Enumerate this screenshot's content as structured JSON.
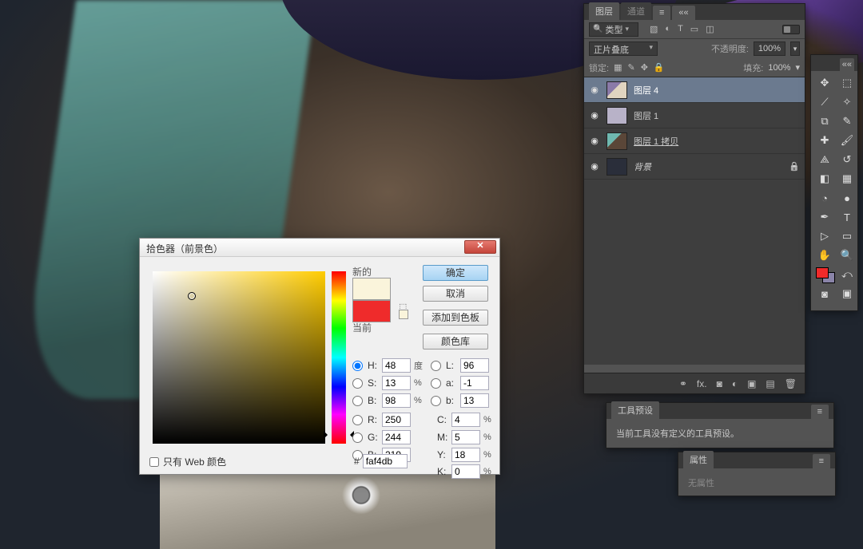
{
  "canvas": {},
  "color_picker": {
    "title": "拾色器（前景色）",
    "new_label": "新的",
    "current_label": "当前",
    "ok": "确定",
    "cancel": "取消",
    "add_swatch": "添加到色板",
    "color_lib": "颜色库",
    "hsb": {
      "h_lbl": "H:",
      "h": "48",
      "h_unit": "度",
      "s_lbl": "S:",
      "s": "13",
      "s_unit": "%",
      "b_lbl": "B:",
      "b": "98",
      "b_unit": "%"
    },
    "lab": {
      "l_lbl": "L:",
      "l": "96",
      "a_lbl": "a:",
      "a": "-1",
      "b_lbl": "b:",
      "b": "13"
    },
    "rgb": {
      "r_lbl": "R:",
      "r": "250",
      "g_lbl": "G:",
      "g": "244",
      "b_lbl": "B:",
      "b": "219"
    },
    "cmyk": {
      "c_lbl": "C:",
      "c": "4",
      "c_unit": "%",
      "m_lbl": "M:",
      "m": "5",
      "m_unit": "%",
      "y_lbl": "Y:",
      "y": "18",
      "y_unit": "%",
      "k_lbl": "K:",
      "k": "0",
      "k_unit": "%"
    },
    "web_only": "只有 Web 颜色",
    "hex_lbl": "#",
    "hex": "faf4db"
  },
  "layers_panel": {
    "tab_layers": "图层",
    "tab_channels": "通道",
    "search_kind": "类型",
    "blend_mode": "正片叠底",
    "opacity_label": "不透明度:",
    "opacity_value": "100%",
    "lock_label": "锁定:",
    "fill_label": "填充:",
    "fill_value": "100%",
    "layers": [
      {
        "name": "图层 4",
        "selected": true,
        "thumb": "lay4"
      },
      {
        "name": "图层 1",
        "selected": false,
        "thumb": "lay1"
      },
      {
        "name": "图层 1 拷贝",
        "selected": false,
        "thumb": "copy",
        "underline": true
      },
      {
        "name": "背景",
        "selected": false,
        "thumb": "bg",
        "italic": true,
        "locked": true
      }
    ]
  },
  "tool_presets": {
    "tab": "工具预设",
    "message": "当前工具没有定义的工具预设。"
  },
  "properties": {
    "tab": "属性",
    "message": "无属性"
  },
  "tools": {
    "items": [
      "move",
      "marquee",
      "lasso",
      "wand",
      "crop",
      "eyedropper",
      "heal",
      "brush",
      "stamp",
      "history",
      "eraser",
      "gradient",
      "blur",
      "dodge",
      "pen",
      "type",
      "path",
      "shape",
      "hand",
      "zoom"
    ]
  }
}
